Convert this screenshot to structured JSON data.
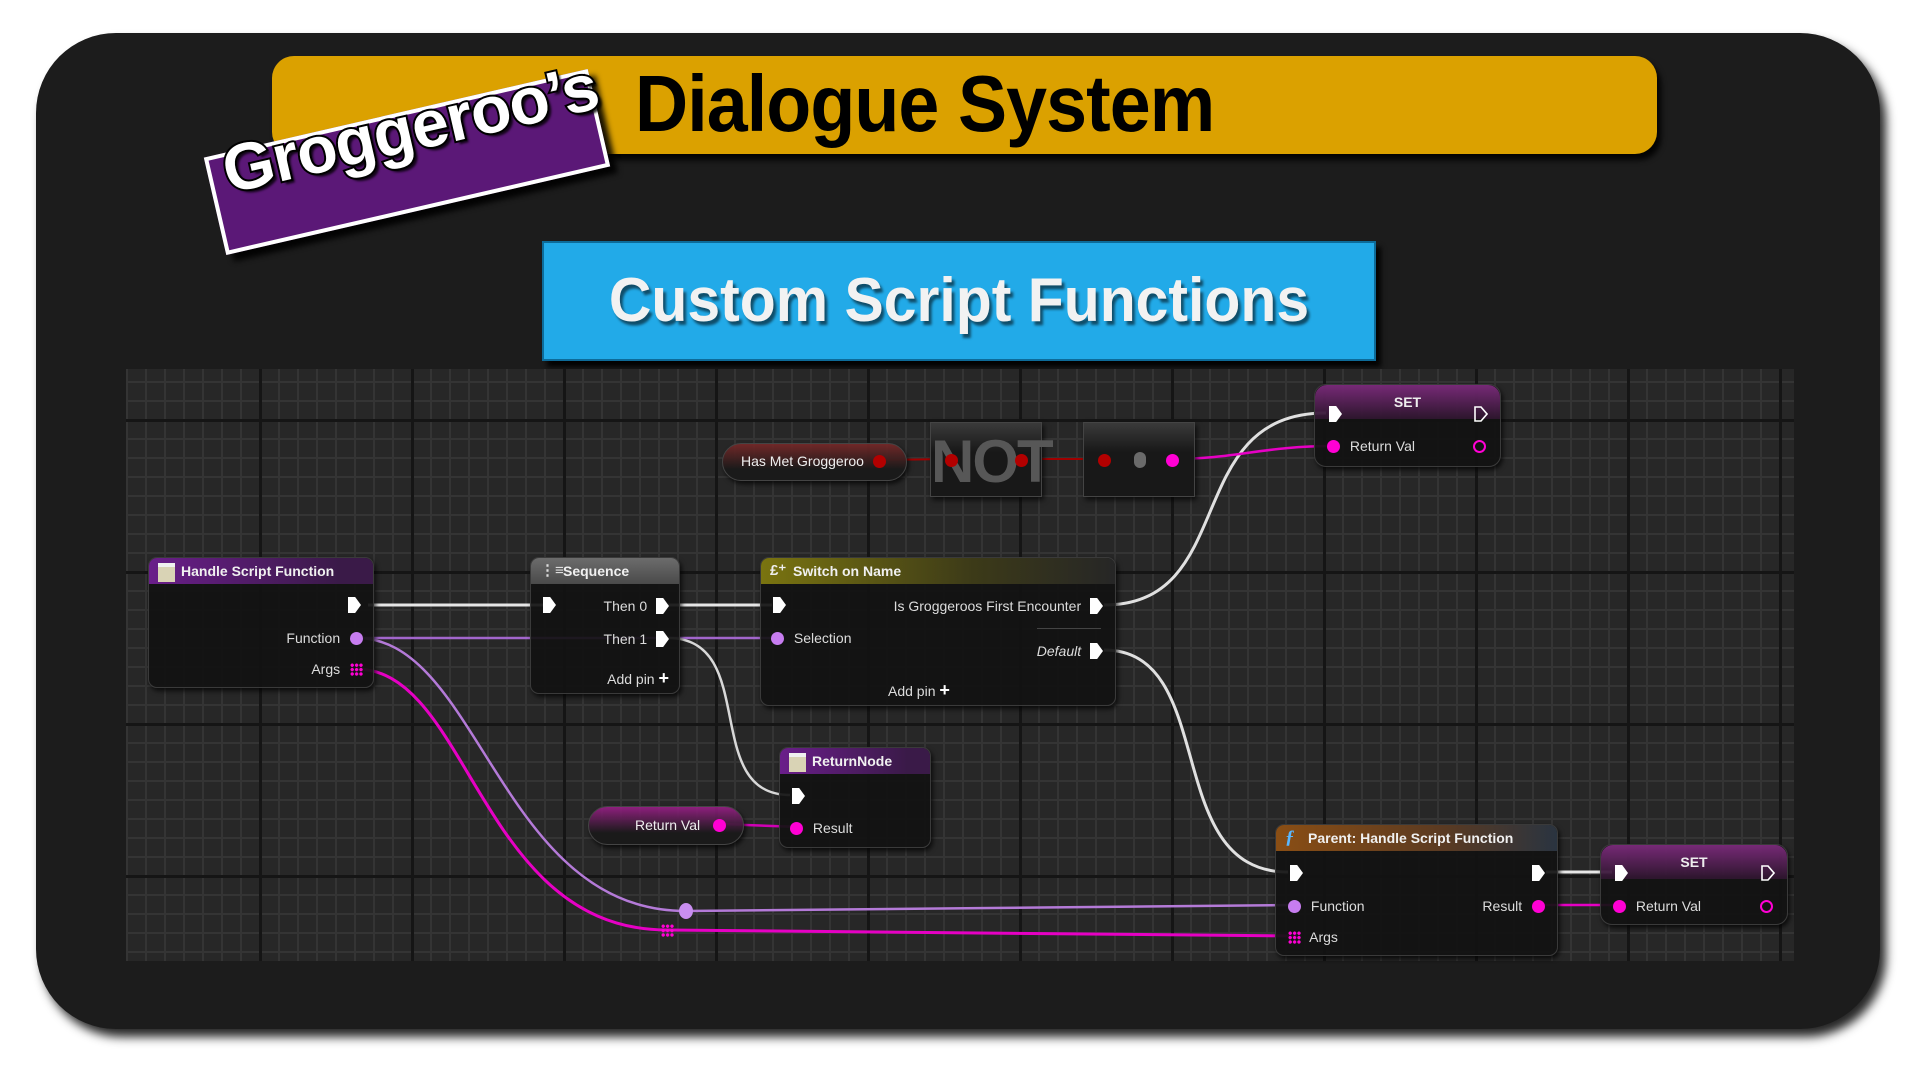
{
  "header": {
    "brand_badge": "Groggeroo’s",
    "title": "Dialogue System",
    "subtitle": "Custom Script Functions"
  },
  "colors": {
    "title_bar": "#dba100",
    "badge": "#5b1877",
    "subtitle_box": "#22aae8",
    "exec_wire": "#e8e8e8",
    "name_pin": "#c77df0",
    "struct_pin": "#ff00d4",
    "bool_pin": "#b30000"
  },
  "graph": {
    "nodes": {
      "handle_script_function": {
        "title": "Handle Script Function",
        "icon": "event-icon",
        "pins": {
          "function": "Function",
          "args": "Args"
        }
      },
      "sequence": {
        "title": "Sequence",
        "icon": "sequence-icon",
        "pins": {
          "then0": "Then 0",
          "then1": "Then 1",
          "add_pin": "Add pin"
        }
      },
      "switch_on_name": {
        "title": "Switch on Name",
        "icon": "switch-icon",
        "pins": {
          "selection": "Selection",
          "case0": "Is Groggeroos First Encounter",
          "default": "Default",
          "add_pin": "Add pin"
        }
      },
      "has_met_var": {
        "label": "Has Met Groggeroo"
      },
      "not_node": {
        "label": "NOT"
      },
      "set_top": {
        "title": "SET",
        "pins": {
          "return_val": "Return Val"
        }
      },
      "return_node": {
        "title": "ReturnNode",
        "icon": "return-icon",
        "pins": {
          "result": "Result"
        }
      },
      "return_val_var": {
        "label": "Return Val"
      },
      "parent_call": {
        "title": "Parent: Handle Script Function",
        "icon": "function-icon",
        "pins": {
          "function": "Function",
          "args": "Args",
          "result": "Result"
        }
      },
      "set_bottom": {
        "title": "SET",
        "pins": {
          "return_val": "Return Val"
        }
      }
    }
  }
}
